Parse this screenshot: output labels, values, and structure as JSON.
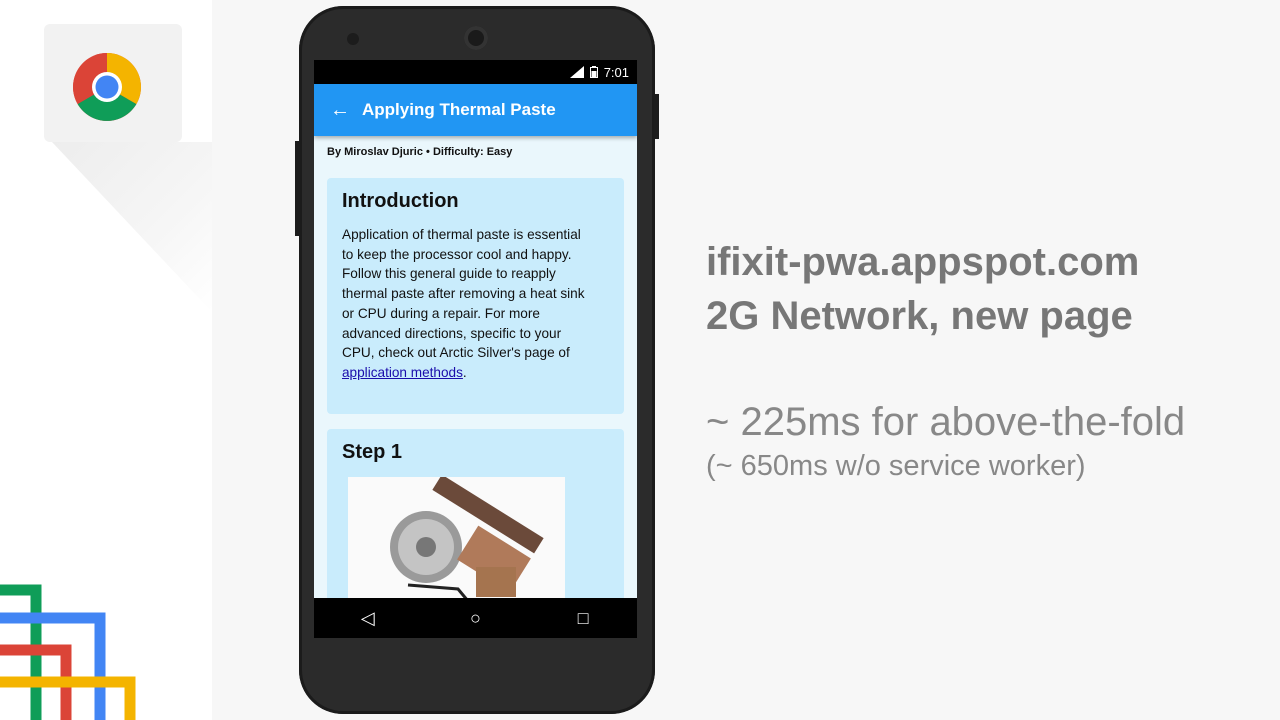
{
  "slide": {
    "line1": "ifixit-pwa.appspot.com",
    "line2": "2G Network, new page",
    "metric_main": "~ 225ms for above-the-fold",
    "metric_sub": "(~ 650ms w/o service worker)"
  },
  "phone": {
    "status_time": "7:01",
    "appbar": {
      "back_icon": "arrow-left-icon",
      "title": "Applying Thermal Paste"
    },
    "byline": "By Miroslav Djuric • Difficulty: Easy",
    "intro": {
      "heading": "Introduction",
      "body_lines": [
        "Application of thermal paste is essential",
        "to keep the processor cool and happy.",
        "Follow this general guide to reapply",
        "thermal paste after removing a heat sink",
        "or CPU during a repair. For more",
        "advanced directions, specific to your",
        "CPU, check out Arctic Silver's page of"
      ],
      "link_text": "application methods",
      "link_tail": "."
    },
    "step": {
      "heading": "Step 1"
    },
    "navbar": {
      "back": "◁",
      "home": "○",
      "recents": "□"
    }
  },
  "colors": {
    "appbar": "#2196f3",
    "card": "#c9ecfc",
    "headline_text": "#777777"
  }
}
